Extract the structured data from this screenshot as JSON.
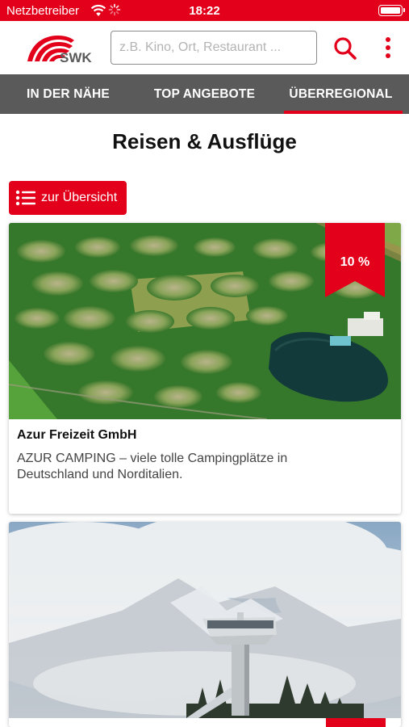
{
  "status_bar": {
    "carrier": "Netzbetreiber",
    "time": "18:22",
    "icons": [
      "wifi-icon",
      "activity-spinner-icon",
      "battery-icon"
    ]
  },
  "header": {
    "logo_text": "SWK",
    "search_placeholder": "z.B. Kino, Ort, Restaurant ...",
    "search_value": "",
    "icons": [
      "search-icon",
      "more-vertical-icon"
    ]
  },
  "tabs": [
    {
      "label": "IN DER NÄHE",
      "active": false
    },
    {
      "label": "TOP ANGEBOTE",
      "active": false
    },
    {
      "label": "ÜBERREGIONAL",
      "active": true
    }
  ],
  "main": {
    "title": "Reisen & Ausflüge",
    "overview_button": {
      "label": "zur Übersicht",
      "icon": "list-icon"
    },
    "cards": [
      {
        "title": "Azur Freizeit GmbH",
        "description": "AZUR CAMPING – viele tolle Campingplätze in Deutschland und Norditalien.",
        "discount": "10 %",
        "image": "aerial-campsite-photo"
      },
      {
        "title": "",
        "description": "",
        "discount": "",
        "image": "ski-jump-tower-photo"
      }
    ]
  },
  "colors": {
    "brand_red": "#e2001a",
    "tab_bar": "#5a5a5a",
    "text_dark": "#111111"
  }
}
